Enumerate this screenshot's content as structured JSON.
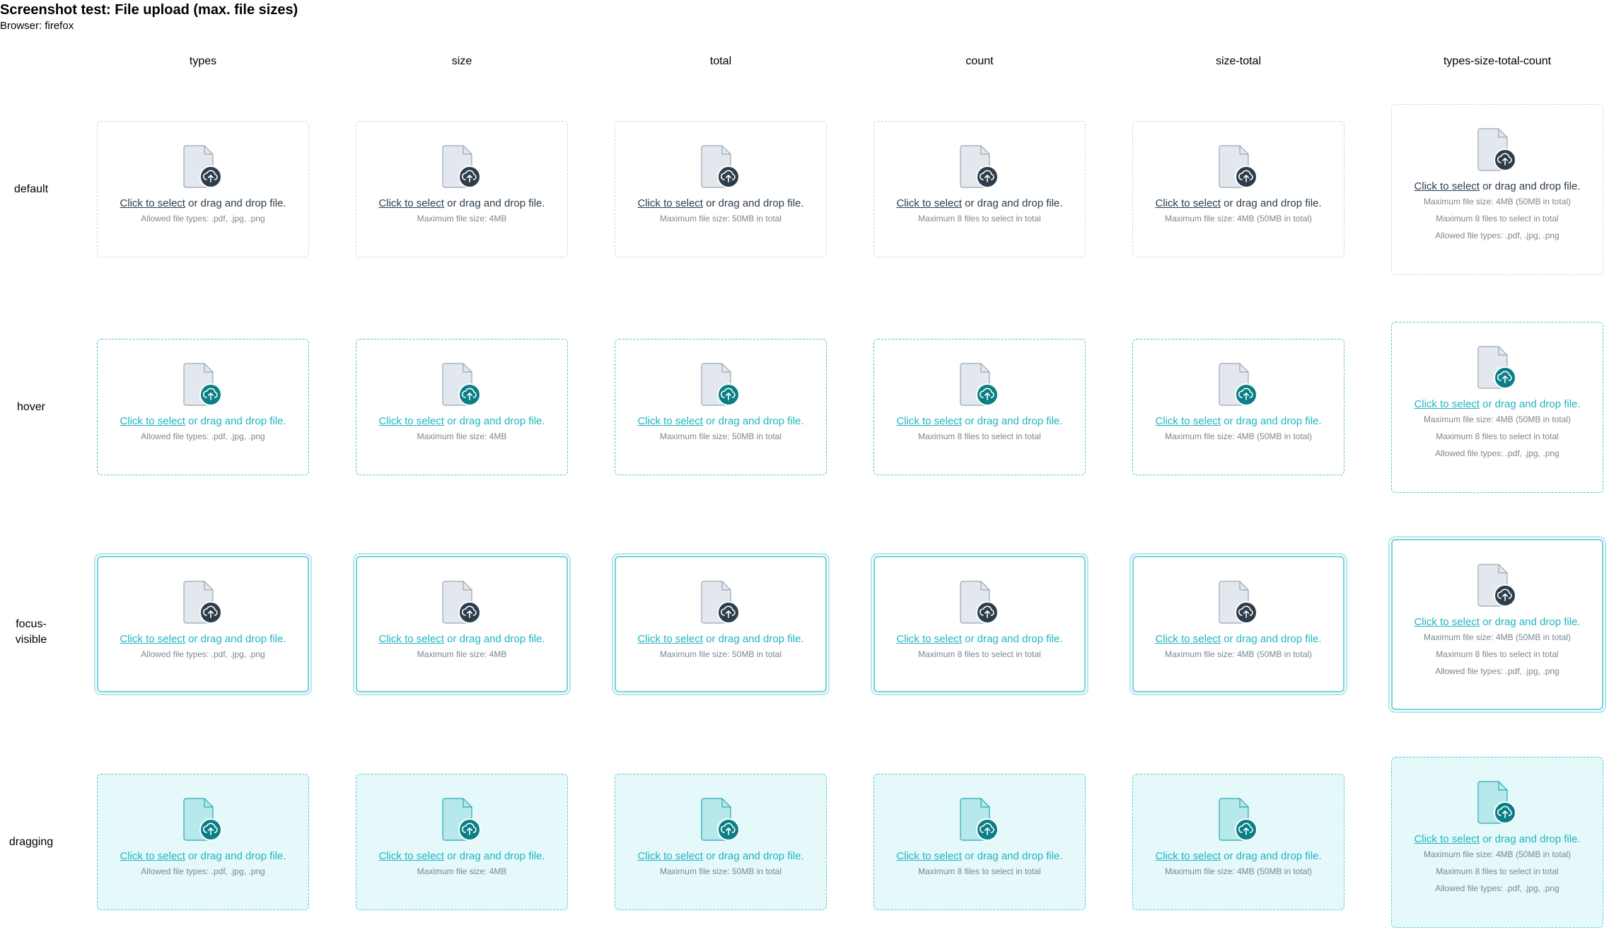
{
  "title": "Screenshot test: File upload (max. file sizes)",
  "browser": "Browser: firefox",
  "columns": [
    "types",
    "size",
    "total",
    "count",
    "size-total",
    "types-size-total-count"
  ],
  "rows": [
    "default",
    "hover",
    "focus-visible",
    "dragging"
  ],
  "dropzone": {
    "select_link": "Click to select",
    "prompt_rest": " or drag and drop file.",
    "icon": "file-upload-icon"
  },
  "hints": {
    "types": [
      "Allowed file types: .pdf, .jpg, .png"
    ],
    "size": [
      "Maximum file size: 4MB"
    ],
    "total": [
      "Maximum file size: 50MB in total"
    ],
    "count": [
      "Maximum 8 files to select in total"
    ],
    "size-total": [
      "Maximum file size: 4MB (50MB in total)"
    ],
    "types-size-total-count": [
      "Maximum file size: 4MB (50MB in total)",
      "Maximum 8 files to select in total",
      "Allowed file types: .pdf, .jpg, .png"
    ]
  },
  "colors": {
    "default_border": "#cfd4da",
    "accent": "#1fb5c2",
    "hover_badge": "#0a7f86",
    "default_badge": "#2d3d4b",
    "dragging_bg": "#e5f8fa"
  }
}
